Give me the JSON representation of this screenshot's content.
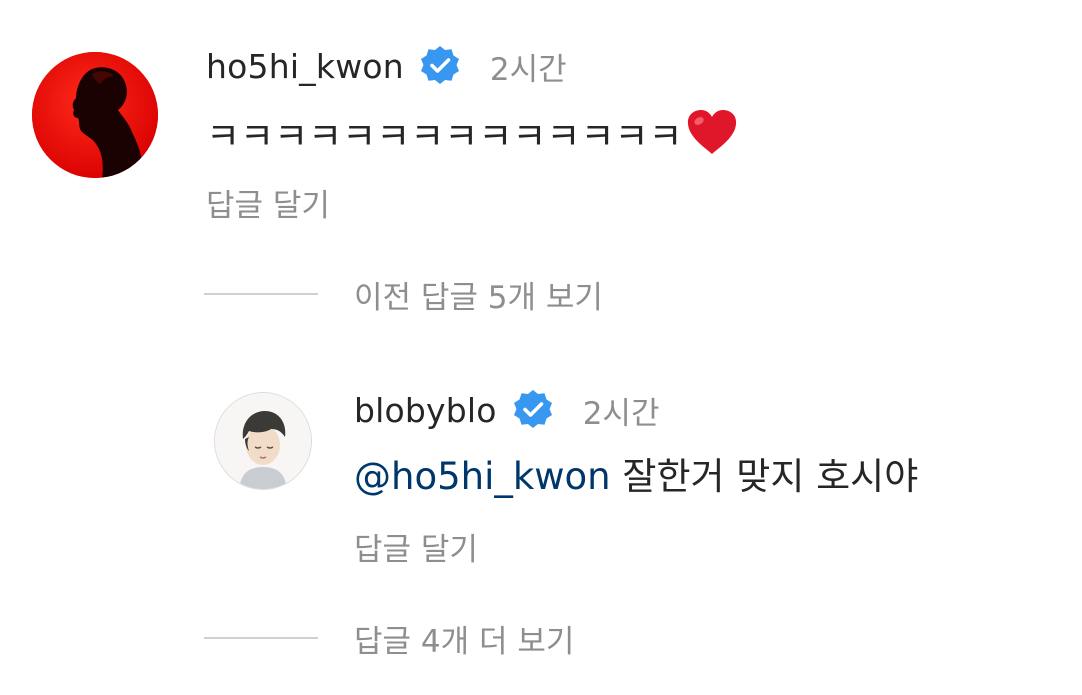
{
  "comments": [
    {
      "username": "ho5hi_kwon",
      "verified": true,
      "time": "2시간",
      "text": "ㅋㅋㅋㅋㅋㅋㅋㅋㅋㅋㅋㅋㅋㅋ",
      "emoji": "heart-emoji",
      "reply_label": "답글 달기",
      "avatar": "red-silhouette-avatar"
    },
    {
      "username": "blobyblo",
      "verified": true,
      "time": "2시간",
      "mention": "@ho5hi_kwon",
      "text": " 잘한거 맞지 호시야",
      "reply_label": "답글 달기",
      "avatar": "illustrated-boy-avatar"
    }
  ],
  "threads": {
    "view_previous": "이전 답글 5개 보기",
    "view_more": "답글 4개 더 보기"
  },
  "colors": {
    "verified_blue": "#3897f0",
    "mention": "#00376b",
    "secondary_text": "#8e8e8e",
    "heart_red": "#e0162b"
  }
}
